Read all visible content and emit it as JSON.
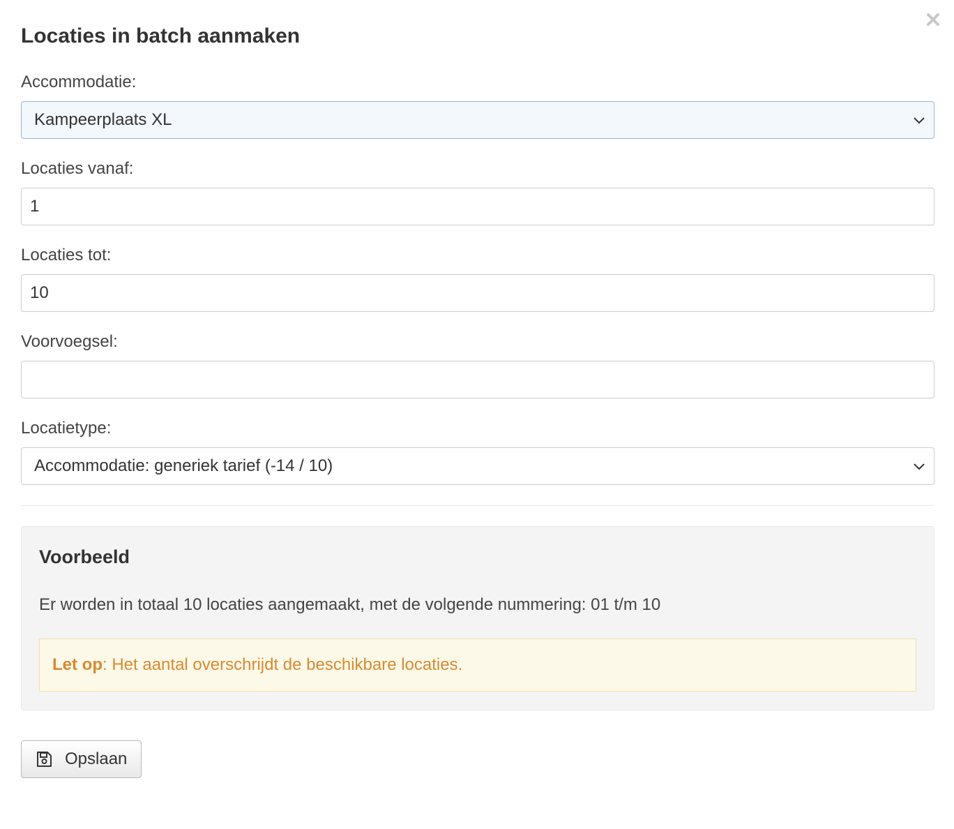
{
  "dialog": {
    "title": "Locaties in batch aanmaken",
    "close_icon": "close-icon"
  },
  "form": {
    "accommodatie": {
      "label": "Accommodatie:",
      "value": "Kampeerplaats XL"
    },
    "locaties_vanaf": {
      "label": "Locaties vanaf:",
      "value": "1"
    },
    "locaties_tot": {
      "label": "Locaties tot:",
      "value": "10"
    },
    "voorvoegsel": {
      "label": "Voorvoegsel:",
      "value": ""
    },
    "locatietype": {
      "label": "Locatietype:",
      "value": "Accommodatie: generiek tarief (-14 / 10)"
    }
  },
  "preview": {
    "title": "Voorbeeld",
    "text": "Er worden in totaal 10 locaties aangemaakt, met de volgende nummering: 01 t/m 10",
    "warning_strong": "Let op",
    "warning_text": ": Het aantal overschrijdt de beschikbare locaties."
  },
  "actions": {
    "save_label": "Opslaan",
    "save_icon": "floppy-disk-icon"
  },
  "colors": {
    "warning_text": "#d88a30",
    "warning_bg": "#fdf9e8",
    "focused_select_bg": "#f3f8fc"
  }
}
